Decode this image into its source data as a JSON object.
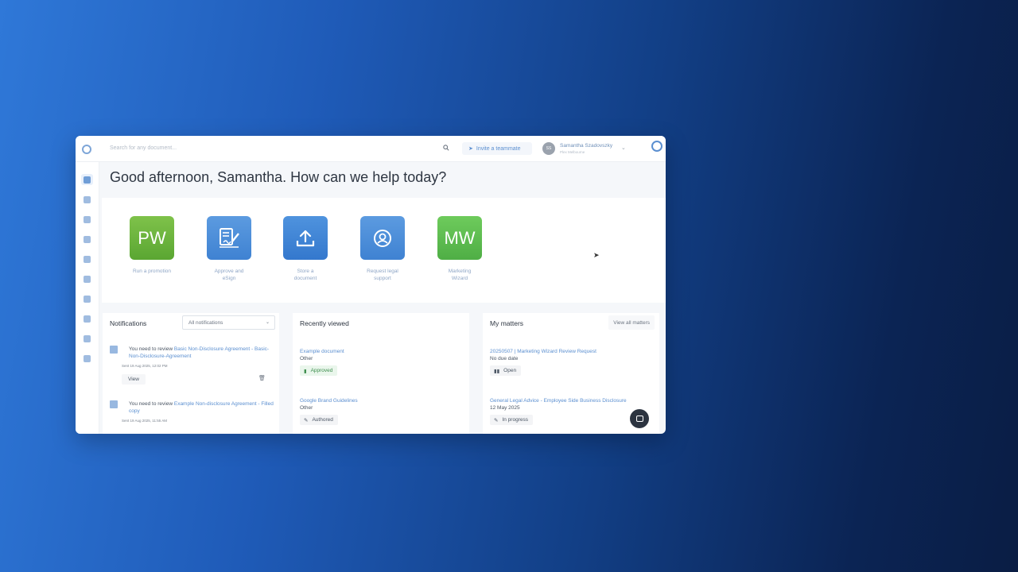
{
  "topbar": {
    "search_placeholder": "Search for any document...",
    "invite_label": "Invite a teammate",
    "user_initials": "SS",
    "user_name": "Samantha Szadovszky",
    "user_org": "Plex Melbourne"
  },
  "greeting": "Good afternoon, Samantha. How can we help today?",
  "tiles": [
    {
      "icon_text": "PW",
      "label_1": "Run a promotion",
      "label_2": "",
      "color": "#6db33f"
    },
    {
      "icon_text": "",
      "icon": "sign-document-icon",
      "label_1": "Approve and",
      "label_2": "eSign",
      "color": "#4a8fd8"
    },
    {
      "icon_text": "",
      "icon": "upload-icon",
      "label_1": "Store a",
      "label_2": "document",
      "color": "#3d86d6"
    },
    {
      "icon_text": "",
      "icon": "person-icon",
      "label_1": "Request legal",
      "label_2": "support",
      "color": "#4a8fd8"
    },
    {
      "icon_text": "MW",
      "label_1": "Marketing",
      "label_2": "Wizard",
      "color": "#5fbf5a"
    }
  ],
  "notifications": {
    "title": "Notifications",
    "filter_value": "All notifications",
    "items": [
      {
        "prefix": "You need to review ",
        "link": "Basic Non-Disclosure Agreement - Basic-Non-Disclosure-Agreement",
        "date": "Sent 19 Aug 2025, 12:02 PM",
        "view_label": "View"
      },
      {
        "prefix": "You need to review ",
        "link": "Example Non-disclosure Agreement - Filled copy",
        "date": "Sent 19 Aug 2025, 11:55 AM",
        "view_label": "View"
      }
    ]
  },
  "recently_viewed": {
    "title": "Recently viewed",
    "items": [
      {
        "name": "Example document",
        "type": "Other",
        "status": "Approved"
      },
      {
        "name": "Google Brand Guidelines",
        "type": "Other",
        "status": "Authored"
      }
    ]
  },
  "matters": {
    "title": "My matters",
    "view_all_label": "View all matters",
    "items": [
      {
        "name": "20250507 | Marketing Wizard Review Request",
        "due": "No due date",
        "status": "Open"
      },
      {
        "name": "General Legal Advice - Employee Side Business Disclosure",
        "due": "12 May 2025",
        "status": "In progress"
      }
    ]
  },
  "colors": {
    "brand_blue": "#5b8fd0",
    "approved_green": "#3f8f4f"
  }
}
